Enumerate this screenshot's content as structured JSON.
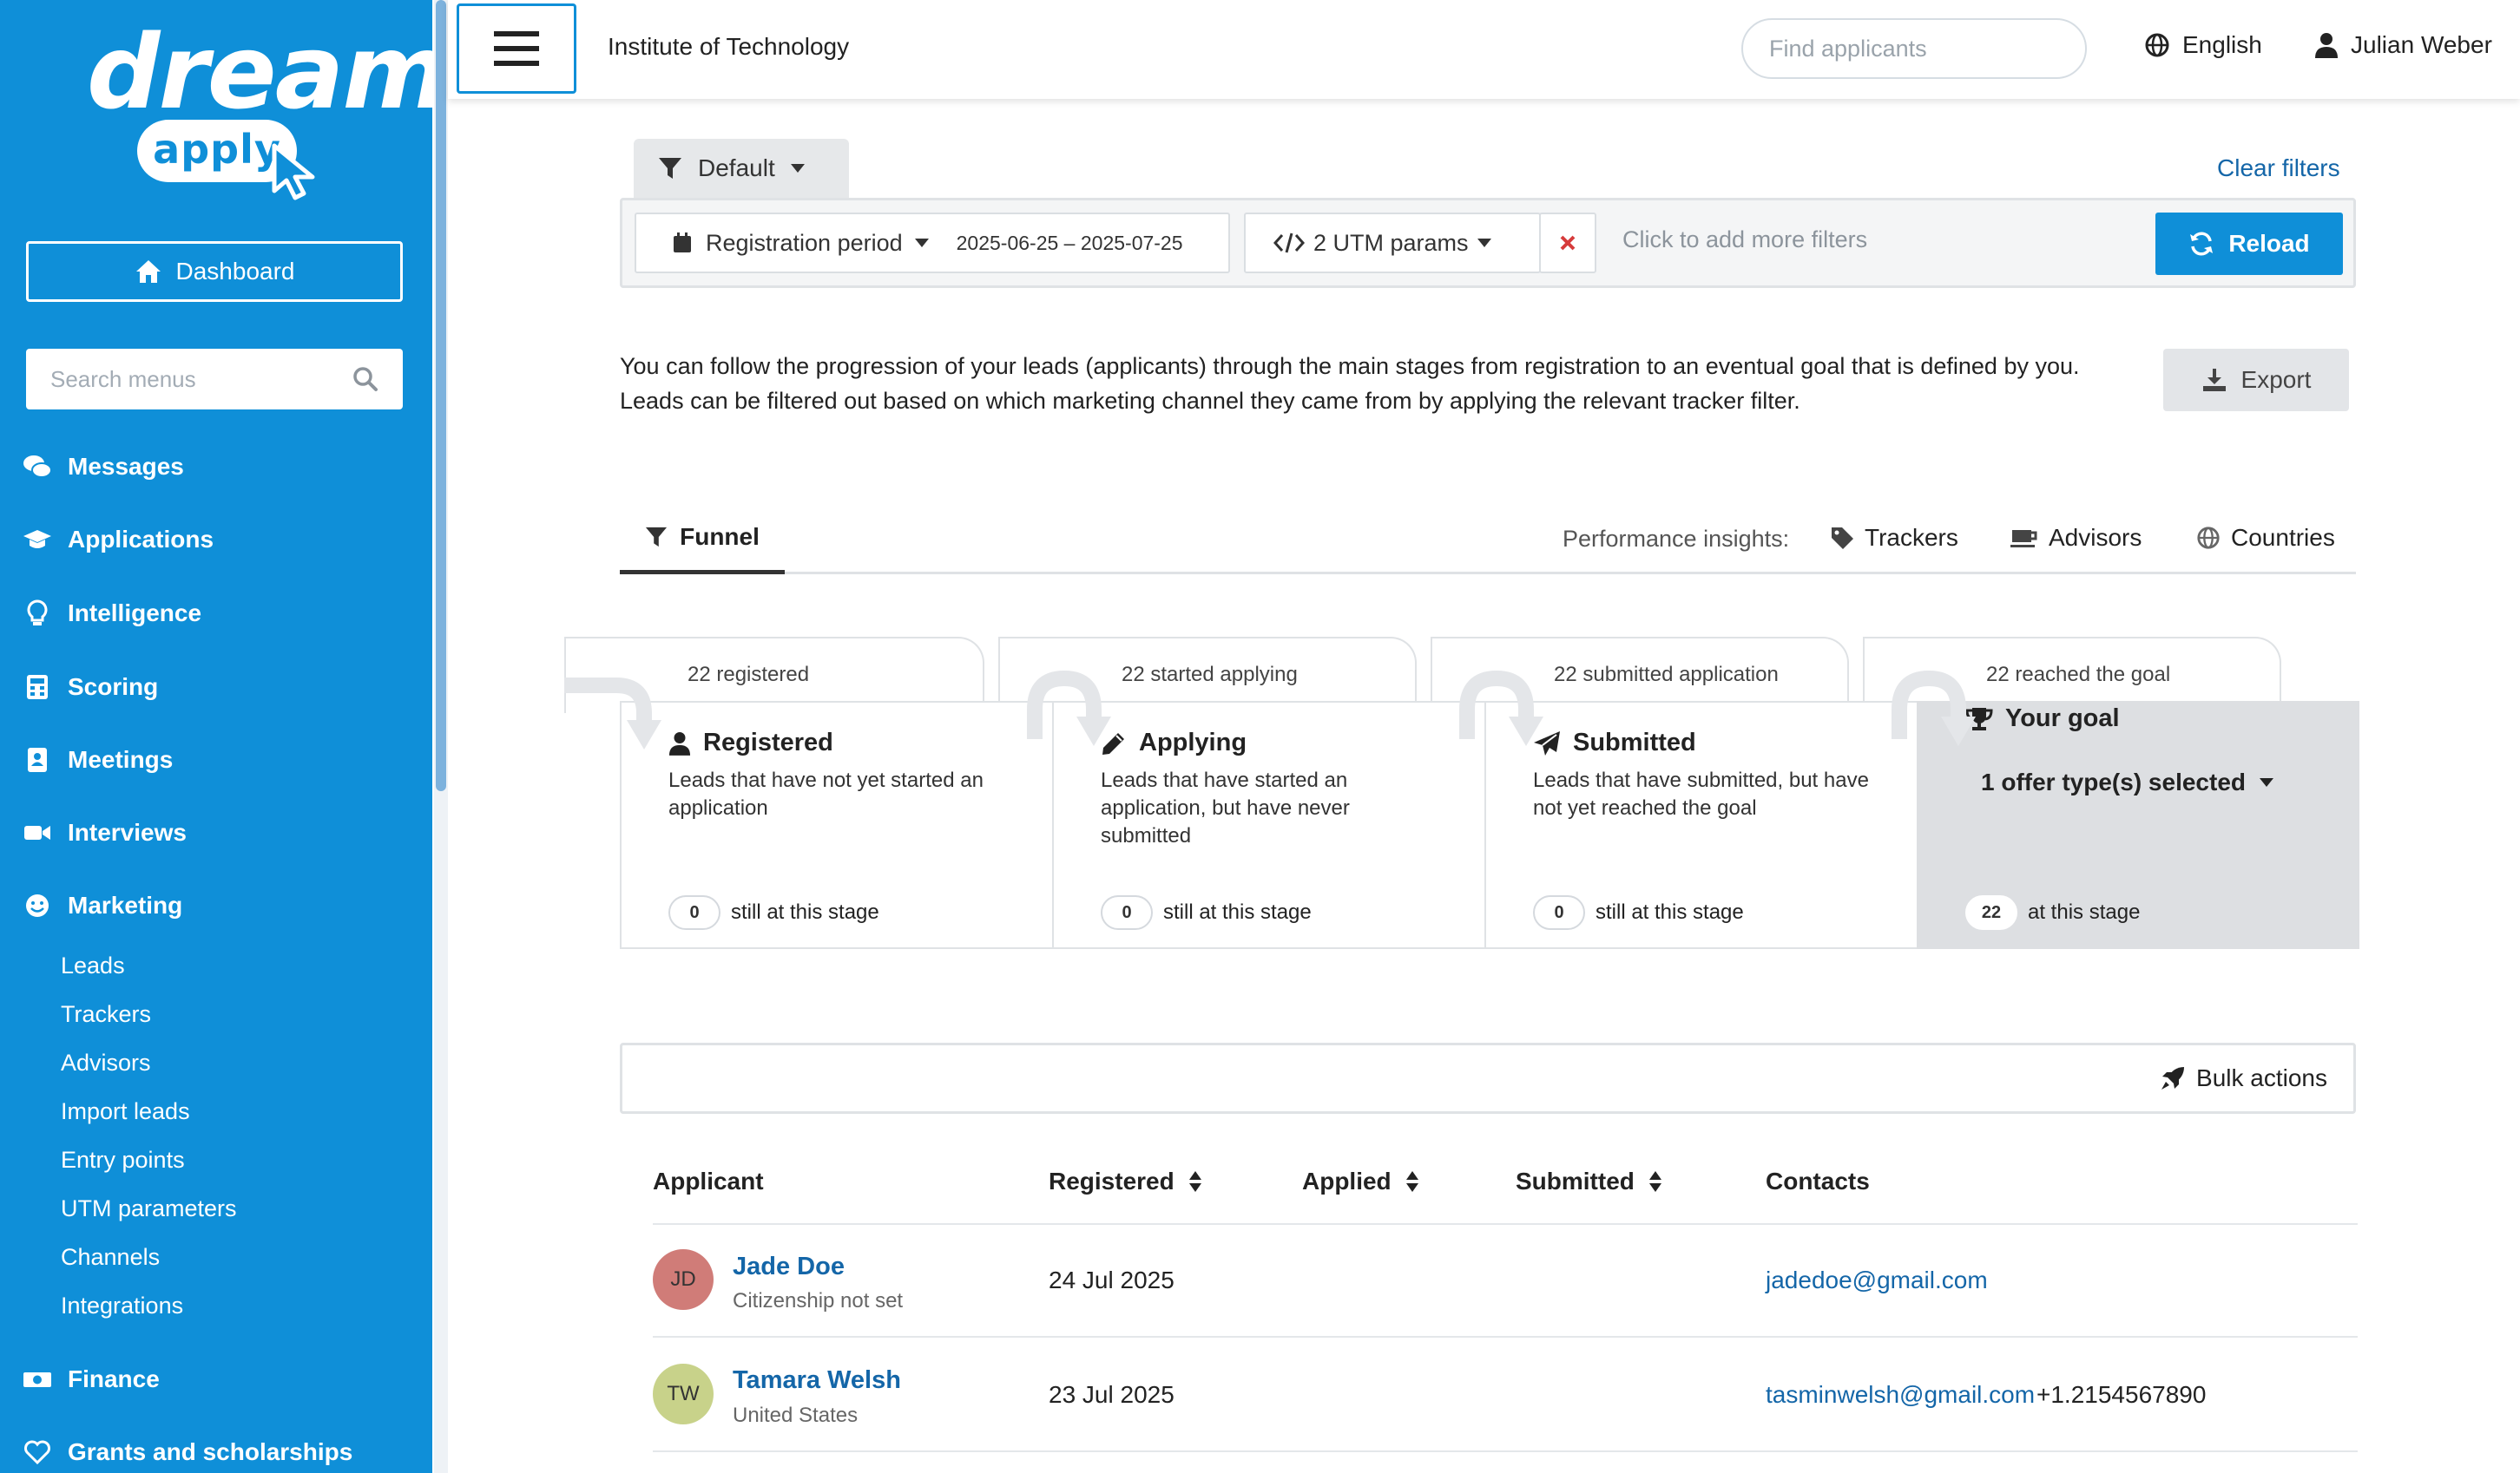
{
  "brand": {
    "word": "dream",
    "pill": "apply"
  },
  "colors": {
    "primary": "#0f8fd8",
    "link": "#1466a8",
    "goal_bg": "#dddfe2"
  },
  "sidebar": {
    "dashboard_label": "Dashboard",
    "search_placeholder": "Search menus",
    "items": [
      {
        "label": "Messages",
        "icon": "comments-icon"
      },
      {
        "label": "Applications",
        "icon": "graduation-cap-icon"
      },
      {
        "label": "Intelligence",
        "icon": "lightbulb-icon"
      },
      {
        "label": "Scoring",
        "icon": "calculator-icon"
      },
      {
        "label": "Meetings",
        "icon": "address-book-icon"
      },
      {
        "label": "Interviews",
        "icon": "video-camera-icon"
      },
      {
        "label": "Marketing",
        "icon": "smile-icon"
      },
      {
        "label": "Finance",
        "icon": "money-icon"
      },
      {
        "label": "Grants and scholarships",
        "icon": "heart-icon"
      }
    ],
    "marketing_sub": [
      "Leads",
      "Trackers",
      "Advisors",
      "Import leads",
      "Entry points",
      "UTM parameters",
      "Channels",
      "Integrations"
    ]
  },
  "header": {
    "institute": "Institute of Technology",
    "search_placeholder": "Find applicants",
    "language": "English",
    "user": "Julian Weber"
  },
  "filters": {
    "preset": "Default",
    "clear": "Clear filters",
    "registration_label": "Registration period",
    "registration_range": "2025-06-25 – 2025-07-25",
    "utm_label": "2 UTM params",
    "add_more": "Click to add more filters",
    "reload": "Reload"
  },
  "description": "You can follow the progression of your leads (applicants) through the main stages from registration to an eventual goal that is defined by you. Leads can be filtered out based on which marketing channel they came from by applying the relevant tracker filter.",
  "export_label": "Export",
  "tabs": {
    "funnel": "Funnel",
    "insights_label": "Performance insights:",
    "insights": [
      "Trackers",
      "Advisors",
      "Countries"
    ]
  },
  "funnel": {
    "stages": [
      {
        "count_label": "22 registered",
        "title": "Registered",
        "icon": "user-icon",
        "desc": "Leads that have not yet started an application",
        "count": "0",
        "foot": "still at this stage"
      },
      {
        "count_label": "22 started applying",
        "title": "Applying",
        "icon": "pencil-icon",
        "desc": "Leads that have started an application, but have never submitted",
        "count": "0",
        "foot": "still at this stage"
      },
      {
        "count_label": "22 submitted application",
        "title": "Submitted",
        "icon": "paper-plane-icon",
        "desc": "Leads that have submitted, but have not yet reached the goal",
        "count": "0",
        "foot": "still at this stage"
      }
    ],
    "goal": {
      "count_label": "22 reached the goal",
      "title": "Your goal",
      "icon": "trophy-icon",
      "select": "1 offer type(s) selected",
      "count": "22",
      "foot": "at this stage"
    }
  },
  "bulk_actions": "Bulk actions",
  "table": {
    "headers": {
      "applicant": "Applicant",
      "registered": "Registered",
      "applied": "Applied",
      "submitted": "Submitted",
      "contacts": "Contacts"
    },
    "rows": [
      {
        "initials": "JD",
        "avatar_color": "#d07c78",
        "name": "Jade Doe",
        "sub": "Citizenship not set",
        "registered": "24 Jul 2025",
        "email": "jadedoe@gmail.com",
        "phone": ""
      },
      {
        "initials": "TW",
        "avatar_color": "#c8d28a",
        "name": "Tamara Welsh",
        "sub": "United States",
        "registered": "23 Jul 2025",
        "email": "tasminwelsh@gmail.com",
        "phone": "+1.2154567890"
      }
    ]
  }
}
